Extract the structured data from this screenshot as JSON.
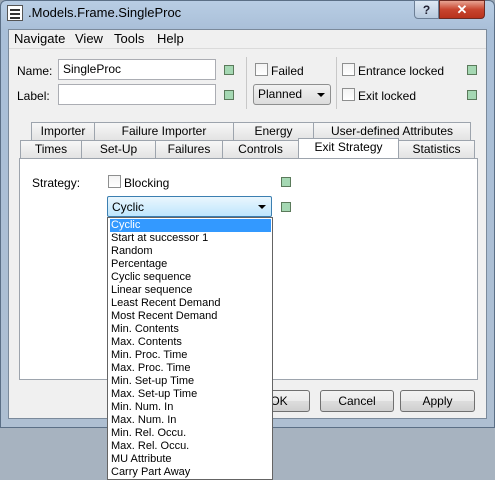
{
  "window": {
    "title": ".Models.Frame.SingleProc",
    "help_label": "?",
    "close_label": "✕"
  },
  "menu": [
    "Navigate",
    "View",
    "Tools",
    "Help"
  ],
  "form": {
    "name_label": "Name:",
    "name_value": "SingleProc",
    "label_label": "Label:",
    "label_value": "",
    "failed_label": "Failed",
    "planned_value": "Planned",
    "entrance_locked_label": "Entrance locked",
    "exit_locked_label": "Exit locked"
  },
  "tabs_back": [
    "Importer",
    "Failure Importer",
    "Energy",
    "User-defined Attributes"
  ],
  "tabs_front": [
    "Times",
    "Set-Up",
    "Failures",
    "Controls",
    "Exit Strategy",
    "Statistics"
  ],
  "active_tab": "Exit Strategy",
  "exit_strategy": {
    "strategy_label": "Strategy:",
    "blocking_label": "Blocking",
    "selected": "Cyclic",
    "options": [
      "Cyclic",
      "Start at successor 1",
      "Random",
      "Percentage",
      "Cyclic sequence",
      "Linear sequence",
      "Least Recent Demand",
      "Most Recent Demand",
      "Min. Contents",
      "Max. Contents",
      "Min. Proc. Time",
      "Max. Proc. Time",
      "Min. Set-up Time",
      "Max. Set-up Time",
      "Min. Num. In",
      "Max. Num. In",
      "Min. Rel. Occu.",
      "Max. Rel. Occu.",
      "MU Attribute",
      "Carry Part Away"
    ]
  },
  "buttons": {
    "ok": "OK",
    "cancel": "Cancel",
    "apply": "Apply"
  },
  "colors": {
    "selection": "#3399ff",
    "status_box": "#a5d8b3",
    "close_button": "#c8452f"
  }
}
